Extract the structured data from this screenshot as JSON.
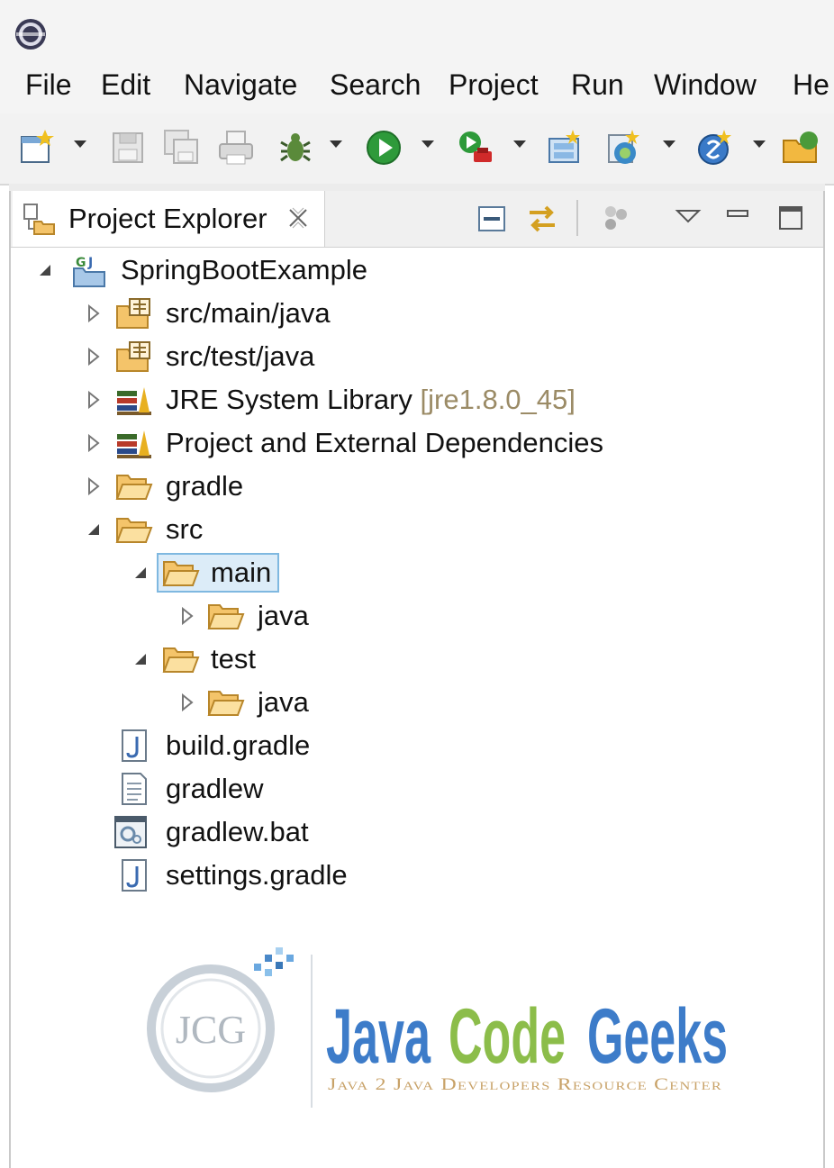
{
  "menubar": {
    "items": [
      "File",
      "Edit",
      "Navigate",
      "Search",
      "Project",
      "Run",
      "Window",
      "He"
    ]
  },
  "toolbar": {
    "icons": [
      "new-wizard-icon",
      "save-icon",
      "save-all-icon",
      "print-icon",
      "debug-icon",
      "run-icon",
      "run-external-tools-icon",
      "new-java-package-icon",
      "new-java-class-icon",
      "new-spring-starter-icon",
      "open-type-icon"
    ]
  },
  "view": {
    "tab_label": "Project Explorer"
  },
  "tree": {
    "project": "SpringBootExample",
    "items": [
      {
        "label": "src/main/java",
        "icon": "source-folder-icon"
      },
      {
        "label": "src/test/java",
        "icon": "source-folder-icon"
      },
      {
        "label": "JRE System Library",
        "decoration": "[jre1.8.0_45]",
        "icon": "library-icon"
      },
      {
        "label": "Project and External Dependencies",
        "icon": "library-icon"
      },
      {
        "label": "gradle",
        "icon": "folder-icon"
      },
      {
        "label": "src",
        "icon": "folder-icon"
      },
      {
        "label": "main",
        "icon": "folder-icon",
        "selected": true
      },
      {
        "label": "java",
        "icon": "folder-icon"
      },
      {
        "label": "test",
        "icon": "folder-icon"
      },
      {
        "label": "java",
        "icon": "folder-icon"
      },
      {
        "label": "build.gradle",
        "icon": "gradle-file-icon"
      },
      {
        "label": "gradlew",
        "icon": "text-file-icon"
      },
      {
        "label": "gradlew.bat",
        "icon": "batch-file-icon"
      },
      {
        "label": "settings.gradle",
        "icon": "gradle-file-icon"
      }
    ]
  },
  "watermark": {
    "monogram": "JCG",
    "title_java": "Java",
    "title_code": "Code",
    "title_geeks": "Geeks",
    "tagline": "Java 2 Java Developers Resource Center"
  },
  "colors": {
    "selection_fill": "#dcecf8",
    "selection_border": "#7fb8e0",
    "folder": "#f4c46a",
    "logo_blue": "#3d7cc9",
    "logo_green": "#8cbd4a"
  }
}
